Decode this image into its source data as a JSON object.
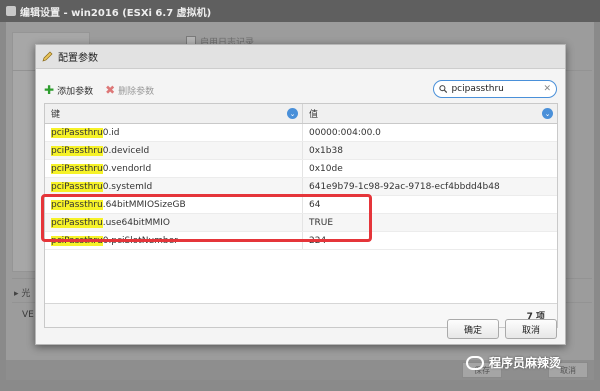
{
  "background": {
    "window_title": "编辑设置 - win2016 (ESXi 6.7 虚拟机)",
    "checkbox_label": "启用日志记录",
    "expand_label": "光",
    "ve_label": "VE",
    "footer_buttons": [
      "保存",
      "取消"
    ]
  },
  "dialog": {
    "title": "配置参数",
    "toolbar": {
      "add_label": "添加参数",
      "delete_label": "删除参数"
    },
    "search": {
      "value": "pcipassthru"
    },
    "columns": [
      "键",
      "值"
    ],
    "rows": [
      {
        "key_hl": "pciPassthru",
        "key_rest": "0.id",
        "value": "00000:004:00.0"
      },
      {
        "key_hl": "pciPassthru",
        "key_rest": "0.deviceId",
        "value": "0x1b38"
      },
      {
        "key_hl": "pciPassthru",
        "key_rest": "0.vendorId",
        "value": "0x10de"
      },
      {
        "key_hl": "pciPassthru",
        "key_rest": "0.systemId",
        "value": "641e9b79-1c98-92ac-9718-ecf4bbdd4b48"
      },
      {
        "key_hl": "pciPassthru",
        "key_rest": ".64bitMMIOSizeGB",
        "value": "64"
      },
      {
        "key_hl": "pciPassthru",
        "key_rest": ".use64bitMMIO",
        "value": "TRUE"
      },
      {
        "key_hl": "pciPassthru",
        "key_rest": "0.pciSlotNumber",
        "value": "224"
      }
    ],
    "count_label": "7 项",
    "ok_label": "确定",
    "cancel_label": "取消"
  },
  "watermark": {
    "text": "程序员麻辣烫"
  },
  "colors": {
    "highlight": "#f6f228",
    "annotation_box": "#e5353a",
    "accent": "#4a90d9"
  }
}
